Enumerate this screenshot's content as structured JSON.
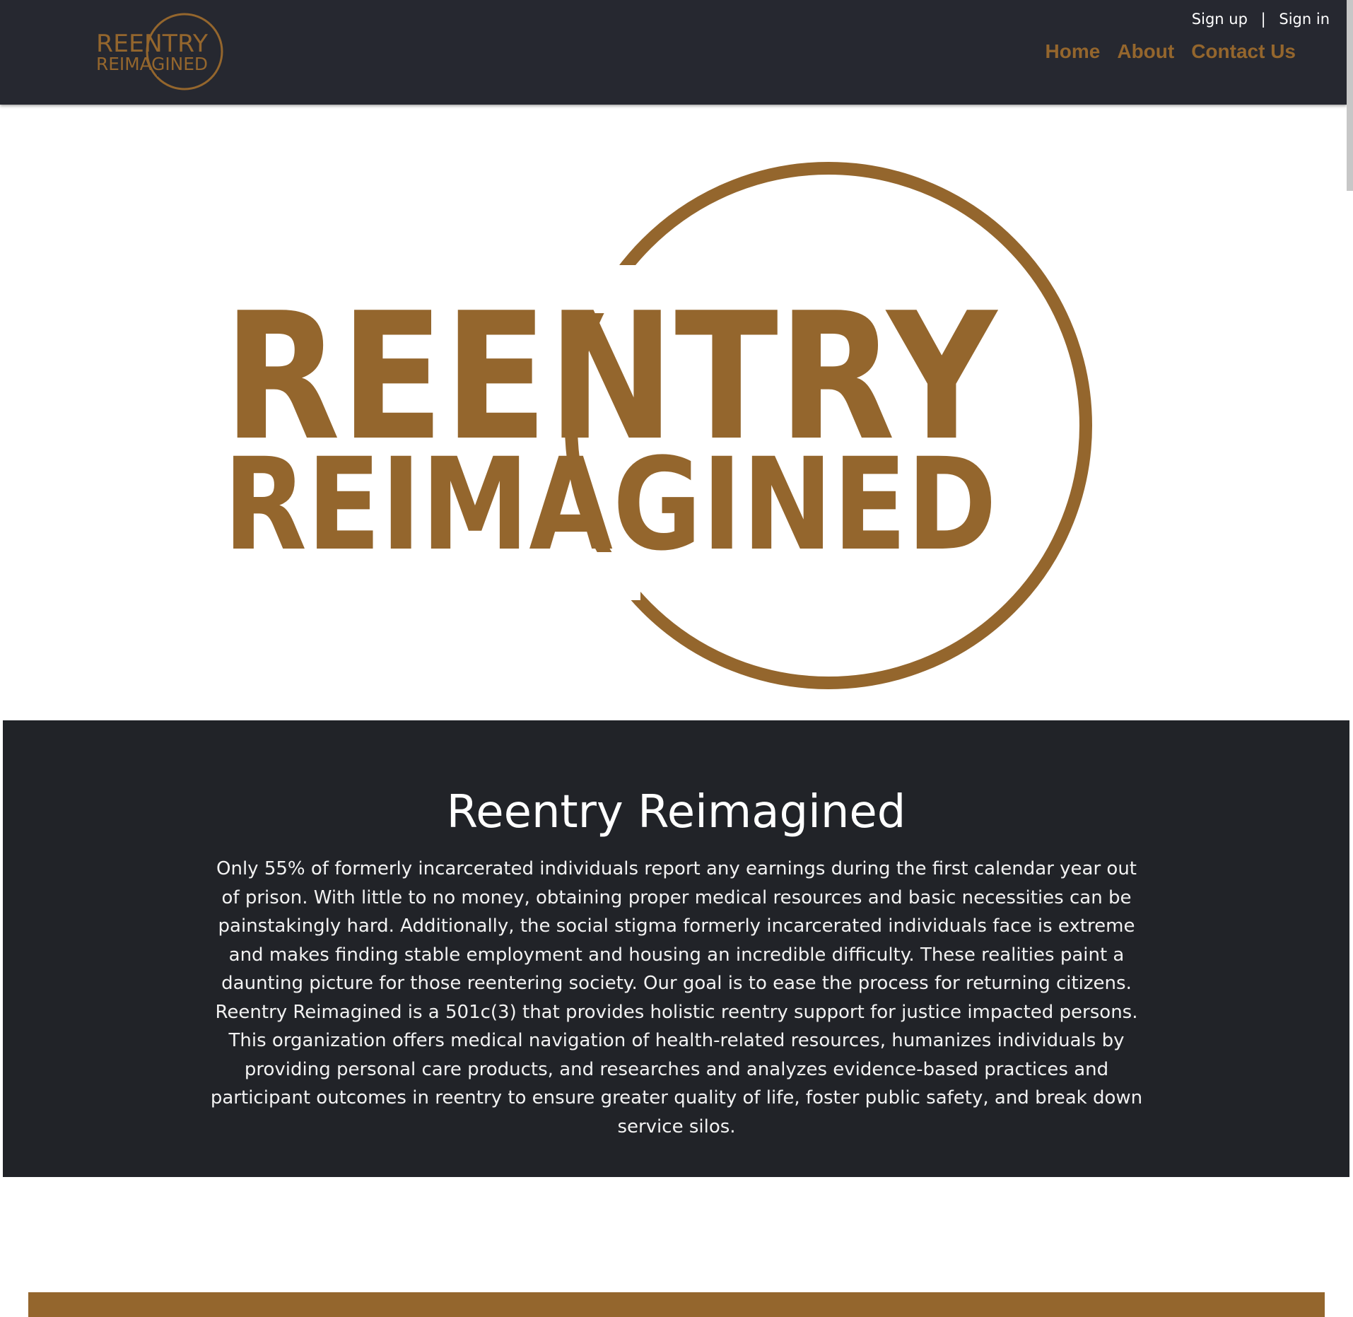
{
  "header": {
    "logo_text": [
      "REENTRY",
      "REIMAGINED"
    ],
    "auth": {
      "sign_up": "Sign up",
      "separator": "|",
      "sign_in": "Sign in"
    },
    "nav": [
      "Home",
      "About",
      "Contact Us"
    ]
  },
  "hero": {
    "logo_text": [
      "REENTRY",
      "REIMAGINED"
    ]
  },
  "about": {
    "title": "Reentry Reimagined",
    "body": "Only 55% of formerly incarcerated individuals report any earnings during the first calendar year out of prison. With little to no money, obtaining proper medical resources and basic necessities can be painstakingly hard. Additionally, the social stigma formerly incarcerated individuals face is extreme and makes finding stable employment and housing an incredible difficulty. These realities paint a daunting picture for those reentering society. Our goal is to ease the process for returning citizens. Reentry Reimagined is a 501c(3) that provides holistic reentry support for justice impacted persons. This organization offers medical navigation of health-related resources, humanizes individuals by providing personal care products, and researches and analyzes evidence-based practices and participant outcomes in reentry to ensure greater quality of life, foster public safety, and break down service silos."
  },
  "colors": {
    "brand_brown": "#94662d",
    "header_bg": "#262830",
    "section_dark": "#212328",
    "text_white": "#ffffff"
  }
}
